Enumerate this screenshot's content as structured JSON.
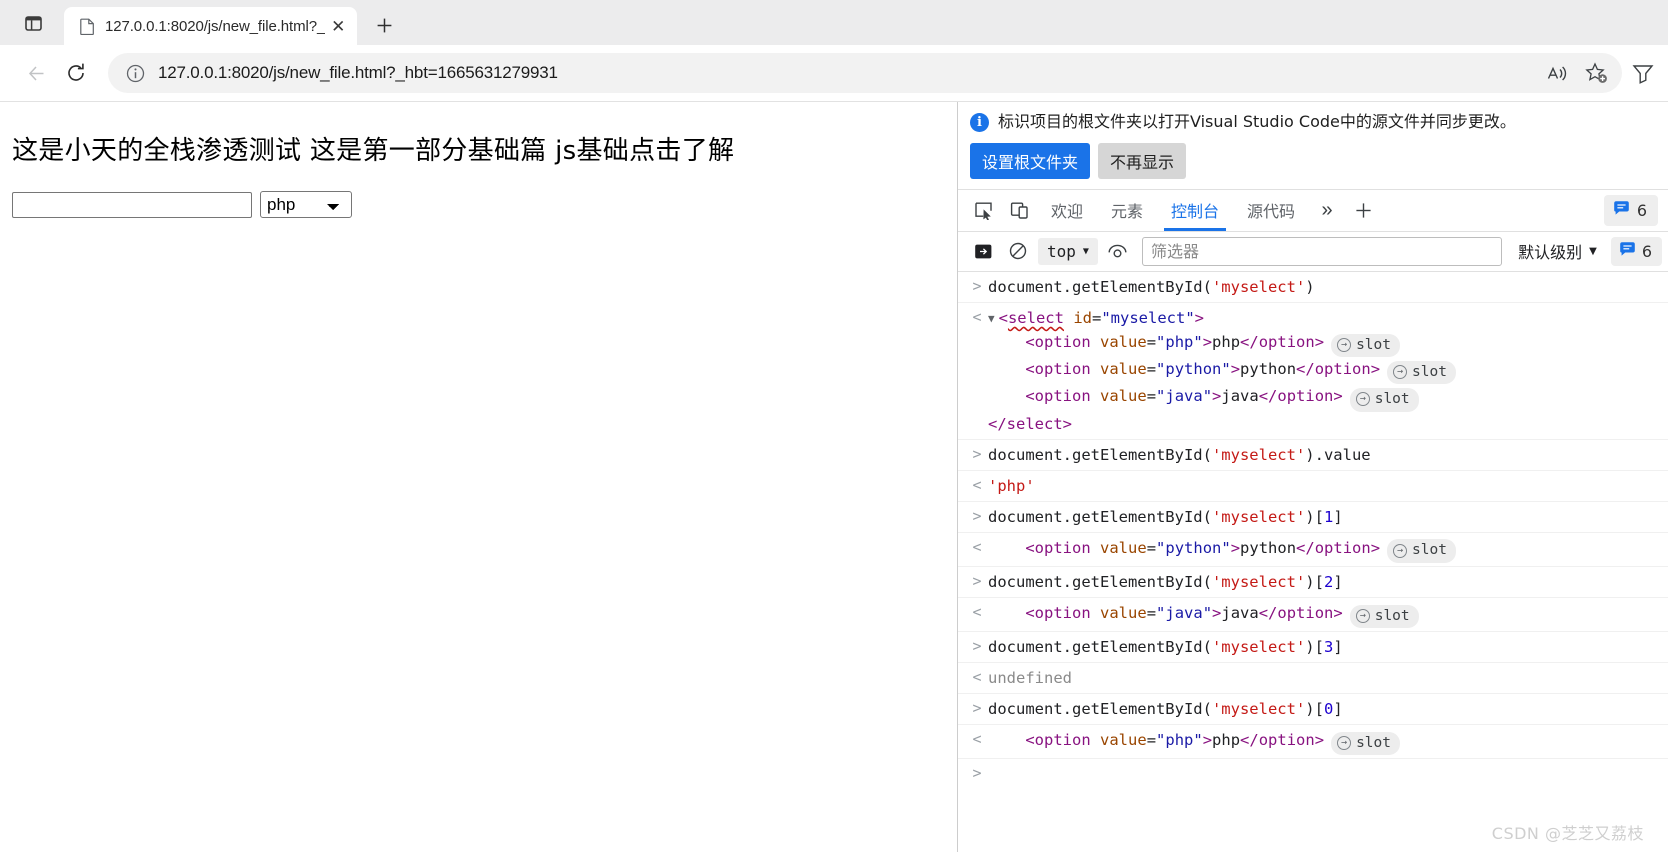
{
  "browser": {
    "tab_list_icon": "tab-list-icon",
    "tab": {
      "favicon": "document-icon",
      "title": "127.0.0.1:8020/js/new_file.html?_",
      "close_label": "✕"
    },
    "new_tab_label": "+",
    "nav": {
      "back_label": "←",
      "reload_label": "⟳"
    },
    "omnibox": {
      "info_icon": "info-circle-icon",
      "url_main": "127.0.0.1",
      "url_rest": ":8020/js/new_file.html?_hbt=1665631279931",
      "url_full": "127.0.0.1:8020/js/new_file.html?_hbt=1665631279931"
    },
    "actions": {
      "read_aloud": "read-aloud-icon",
      "add_favorite": "add-favorite-star-icon",
      "collections": "collections-icon"
    }
  },
  "page": {
    "heading": "这是小天的全栈渗透测试 这是第一部分基础篇 js基础点击了解",
    "text_input": {
      "value": "",
      "placeholder": ""
    },
    "select": {
      "selected": "php",
      "options": [
        "php",
        "python",
        "java"
      ]
    }
  },
  "devtools": {
    "infobar": {
      "icon": "info-icon",
      "message": "标识项目的根文件夹以打开Visual Studio Code中的源文件并同步更改。",
      "primary_button": "设置根文件夹",
      "secondary_button": "不再显示"
    },
    "tabbar": {
      "inspect_icon": "inspect-element-icon",
      "device_icon": "device-toolbar-icon",
      "tabs": [
        {
          "label": "欢迎",
          "active": false
        },
        {
          "label": "元素",
          "active": false
        },
        {
          "label": "控制台",
          "active": true
        },
        {
          "label": "源代码",
          "active": false
        }
      ],
      "more_label": "»",
      "plus_label": "+",
      "badge": {
        "icon": "message-bubble-icon",
        "count": "6"
      }
    },
    "consolebar": {
      "sidebar_icon": "console-sidebar-icon",
      "clear_icon": "clear-console-icon",
      "context_label": "top",
      "eye_icon": "live-expression-eye-icon",
      "filter_placeholder": "筛选器",
      "filter_value": "",
      "level_label": "默认级别",
      "badge": {
        "icon": "message-bubble-icon",
        "count": "6"
      }
    },
    "console_entries": [
      {
        "kind": "input",
        "gutter": ">",
        "tokens": [
          {
            "t": "document.getElementById(",
            "c": "t-plain"
          },
          {
            "t": "'myselect'",
            "c": "t-string"
          },
          {
            "t": ")",
            "c": "t-plain"
          }
        ]
      },
      {
        "kind": "output-multiline",
        "gutter": "<",
        "lines": [
          {
            "indent": 0,
            "expander": "▼",
            "tokens": [
              {
                "t": "<",
                "c": "t-angle"
              },
              {
                "t": "select",
                "c": "t-tag sel-underline"
              },
              {
                "t": " ",
                "c": "t-plain"
              },
              {
                "t": "id",
                "c": "t-attr"
              },
              {
                "t": "=",
                "c": "t-plain"
              },
              {
                "t": "\"myselect\"",
                "c": "t-attrval"
              },
              {
                "t": ">",
                "c": "t-angle"
              }
            ]
          },
          {
            "indent": 1,
            "tokens": [
              {
                "t": "<",
                "c": "t-angle"
              },
              {
                "t": "option",
                "c": "t-tag"
              },
              {
                "t": " ",
                "c": "t-plain"
              },
              {
                "t": "value",
                "c": "t-attr"
              },
              {
                "t": "=",
                "c": "t-plain"
              },
              {
                "t": "\"php\"",
                "c": "t-attrval"
              },
              {
                "t": ">",
                "c": "t-angle"
              },
              {
                "t": "php",
                "c": "t-text"
              },
              {
                "t": "</",
                "c": "t-angle"
              },
              {
                "t": "option",
                "c": "t-tag"
              },
              {
                "t": ">",
                "c": "t-angle"
              }
            ],
            "chip": "slot"
          },
          {
            "indent": 1,
            "tokens": [
              {
                "t": "<",
                "c": "t-angle"
              },
              {
                "t": "option",
                "c": "t-tag"
              },
              {
                "t": " ",
                "c": "t-plain"
              },
              {
                "t": "value",
                "c": "t-attr"
              },
              {
                "t": "=",
                "c": "t-plain"
              },
              {
                "t": "\"python\"",
                "c": "t-attrval"
              },
              {
                "t": ">",
                "c": "t-angle"
              },
              {
                "t": "python",
                "c": "t-text"
              },
              {
                "t": "</",
                "c": "t-angle"
              },
              {
                "t": "option",
                "c": "t-tag"
              },
              {
                "t": ">",
                "c": "t-angle"
              }
            ],
            "chip": "slot"
          },
          {
            "indent": 1,
            "tokens": [
              {
                "t": "<",
                "c": "t-angle"
              },
              {
                "t": "option",
                "c": "t-tag"
              },
              {
                "t": " ",
                "c": "t-plain"
              },
              {
                "t": "value",
                "c": "t-attr"
              },
              {
                "t": "=",
                "c": "t-plain"
              },
              {
                "t": "\"java\"",
                "c": "t-attrval"
              },
              {
                "t": ">",
                "c": "t-angle"
              },
              {
                "t": "java",
                "c": "t-text"
              },
              {
                "t": "</",
                "c": "t-angle"
              },
              {
                "t": "option",
                "c": "t-tag"
              },
              {
                "t": ">",
                "c": "t-angle"
              }
            ],
            "chip": "slot"
          },
          {
            "indent": 0,
            "tokens": [
              {
                "t": "</",
                "c": "t-angle"
              },
              {
                "t": "select",
                "c": "t-tag"
              },
              {
                "t": ">",
                "c": "t-angle"
              }
            ]
          }
        ]
      },
      {
        "kind": "input",
        "gutter": ">",
        "tokens": [
          {
            "t": "document.getElementById(",
            "c": "t-plain"
          },
          {
            "t": "'myselect'",
            "c": "t-string"
          },
          {
            "t": ").value",
            "c": "t-plain"
          }
        ]
      },
      {
        "kind": "output",
        "gutter": "<",
        "tokens": [
          {
            "t": "'php'",
            "c": "t-strpink"
          }
        ]
      },
      {
        "kind": "input",
        "gutter": ">",
        "tokens": [
          {
            "t": "document.getElementById(",
            "c": "t-plain"
          },
          {
            "t": "'myselect'",
            "c": "t-string"
          },
          {
            "t": ")[",
            "c": "t-plain"
          },
          {
            "t": "1",
            "c": "t-num"
          },
          {
            "t": "]",
            "c": "t-plain"
          }
        ]
      },
      {
        "kind": "output",
        "gutter": "<",
        "indent": 1,
        "tokens": [
          {
            "t": "<",
            "c": "t-angle"
          },
          {
            "t": "option",
            "c": "t-tag"
          },
          {
            "t": " ",
            "c": "t-plain"
          },
          {
            "t": "value",
            "c": "t-attr"
          },
          {
            "t": "=",
            "c": "t-plain"
          },
          {
            "t": "\"python\"",
            "c": "t-attrval"
          },
          {
            "t": ">",
            "c": "t-angle"
          },
          {
            "t": "python",
            "c": "t-text"
          },
          {
            "t": "</",
            "c": "t-angle"
          },
          {
            "t": "option",
            "c": "t-tag"
          },
          {
            "t": ">",
            "c": "t-angle"
          }
        ],
        "chip": "slot"
      },
      {
        "kind": "input",
        "gutter": ">",
        "tokens": [
          {
            "t": "document.getElementById(",
            "c": "t-plain"
          },
          {
            "t": "'myselect'",
            "c": "t-string"
          },
          {
            "t": ")[",
            "c": "t-plain"
          },
          {
            "t": "2",
            "c": "t-num"
          },
          {
            "t": "]",
            "c": "t-plain"
          }
        ]
      },
      {
        "kind": "output",
        "gutter": "<",
        "indent": 1,
        "tokens": [
          {
            "t": "<",
            "c": "t-angle"
          },
          {
            "t": "option",
            "c": "t-tag"
          },
          {
            "t": " ",
            "c": "t-plain"
          },
          {
            "t": "value",
            "c": "t-attr"
          },
          {
            "t": "=",
            "c": "t-plain"
          },
          {
            "t": "\"java\"",
            "c": "t-attrval"
          },
          {
            "t": ">",
            "c": "t-angle"
          },
          {
            "t": "java",
            "c": "t-text"
          },
          {
            "t": "</",
            "c": "t-angle"
          },
          {
            "t": "option",
            "c": "t-tag"
          },
          {
            "t": ">",
            "c": "t-angle"
          }
        ],
        "chip": "slot"
      },
      {
        "kind": "input",
        "gutter": ">",
        "tokens": [
          {
            "t": "document.getElementById(",
            "c": "t-plain"
          },
          {
            "t": "'myselect'",
            "c": "t-string"
          },
          {
            "t": ")[",
            "c": "t-plain"
          },
          {
            "t": "3",
            "c": "t-num"
          },
          {
            "t": "]",
            "c": "t-plain"
          }
        ]
      },
      {
        "kind": "output",
        "gutter": "<",
        "tokens": [
          {
            "t": "undefined",
            "c": "t-undef"
          }
        ]
      },
      {
        "kind": "input",
        "gutter": ">",
        "tokens": [
          {
            "t": "document.getElementById(",
            "c": "t-plain"
          },
          {
            "t": "'myselect'",
            "c": "t-string"
          },
          {
            "t": ")[",
            "c": "t-plain"
          },
          {
            "t": "0",
            "c": "t-num"
          },
          {
            "t": "]",
            "c": "t-plain"
          }
        ]
      },
      {
        "kind": "output",
        "gutter": "<",
        "indent": 1,
        "tokens": [
          {
            "t": "<",
            "c": "t-angle"
          },
          {
            "t": "option",
            "c": "t-tag"
          },
          {
            "t": " ",
            "c": "t-plain"
          },
          {
            "t": "value",
            "c": "t-attr"
          },
          {
            "t": "=",
            "c": "t-plain"
          },
          {
            "t": "\"php\"",
            "c": "t-attrval"
          },
          {
            "t": ">",
            "c": "t-angle"
          },
          {
            "t": "php",
            "c": "t-text"
          },
          {
            "t": "</",
            "c": "t-angle"
          },
          {
            "t": "option",
            "c": "t-tag"
          },
          {
            "t": ">",
            "c": "t-angle"
          }
        ],
        "chip": "slot"
      },
      {
        "kind": "prompt",
        "gutter": ">",
        "tokens": []
      }
    ]
  },
  "watermark": "CSDN @芝芝又荔枝",
  "colors": {
    "accent_blue": "#1a73e8",
    "tab_active_underline": "#1a73e8",
    "string_red": "#c41a16",
    "number_blue": "#1c00cf",
    "tag_purple": "#881280",
    "attr_orange": "#994500",
    "attrval_blue": "#1a1aa6"
  }
}
